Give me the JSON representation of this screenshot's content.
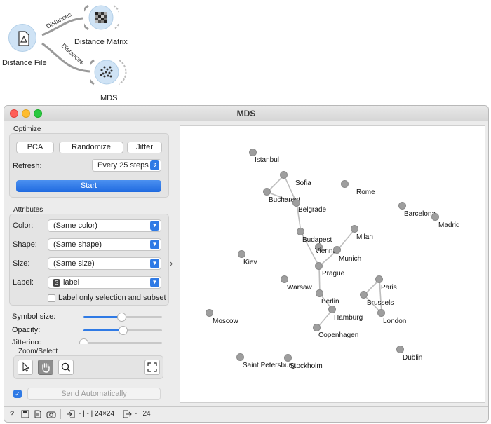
{
  "workflow": {
    "nodes": {
      "distance_file": "Distance File",
      "distance_matrix": "Distance Matrix",
      "mds": "MDS"
    },
    "links": {
      "to_matrix": "Distances",
      "to_mds": "Distances"
    }
  },
  "window": {
    "title": "MDS"
  },
  "optimize": {
    "header": "Optimize",
    "pca": "PCA",
    "randomize": "Randomize",
    "jitter": "Jitter",
    "refresh_label": "Refresh:",
    "refresh_value": "Every 25 steps",
    "start": "Start"
  },
  "attributes": {
    "header": "Attributes",
    "color_label": "Color:",
    "color_value": "(Same color)",
    "shape_label": "Shape:",
    "shape_value": "(Same shape)",
    "size_label": "Size:",
    "size_value": "(Same size)",
    "label_label": "Label:",
    "label_value": "label",
    "label_only_selection": "Label only selection and subset"
  },
  "sliders": {
    "symbol_size_label": "Symbol size:",
    "symbol_size": 0.48,
    "opacity_label": "Opacity:",
    "opacity": 0.5,
    "jittering_label": "Jittering:",
    "jittering": 0.0
  },
  "zoom_select": {
    "header": "Zoom/Select"
  },
  "send": {
    "checked": true,
    "label": "Send Automatically"
  },
  "status": {
    "input_info": "- | - | 24×24",
    "output_info": "- | 24"
  },
  "colors": {
    "accent": "#2f7ae5",
    "point": "#9e9e9e",
    "edge": "#bdbdbd"
  },
  "plot": {
    "points": [
      {
        "label": "Istanbul"
      },
      {
        "label": "Sofia"
      },
      {
        "label": "Bucharest"
      },
      {
        "label": "Belgrade"
      },
      {
        "label": "Rome"
      },
      {
        "label": "Barcelona"
      },
      {
        "label": "Madrid"
      },
      {
        "label": "Budapest"
      },
      {
        "label": "Milan"
      },
      {
        "label": "Vienna"
      },
      {
        "label": "Munich"
      },
      {
        "label": "Kiev"
      },
      {
        "label": "Prague"
      },
      {
        "label": "Warsaw"
      },
      {
        "label": "Paris"
      },
      {
        "label": "Brussels"
      },
      {
        "label": "Berlin"
      },
      {
        "label": "London"
      },
      {
        "label": "Hamburg"
      },
      {
        "label": "Moscow"
      },
      {
        "label": "Copenhagen"
      },
      {
        "label": "Dublin"
      },
      {
        "label": "Saint Petersburg"
      },
      {
        "label": "Stockholm"
      }
    ]
  }
}
